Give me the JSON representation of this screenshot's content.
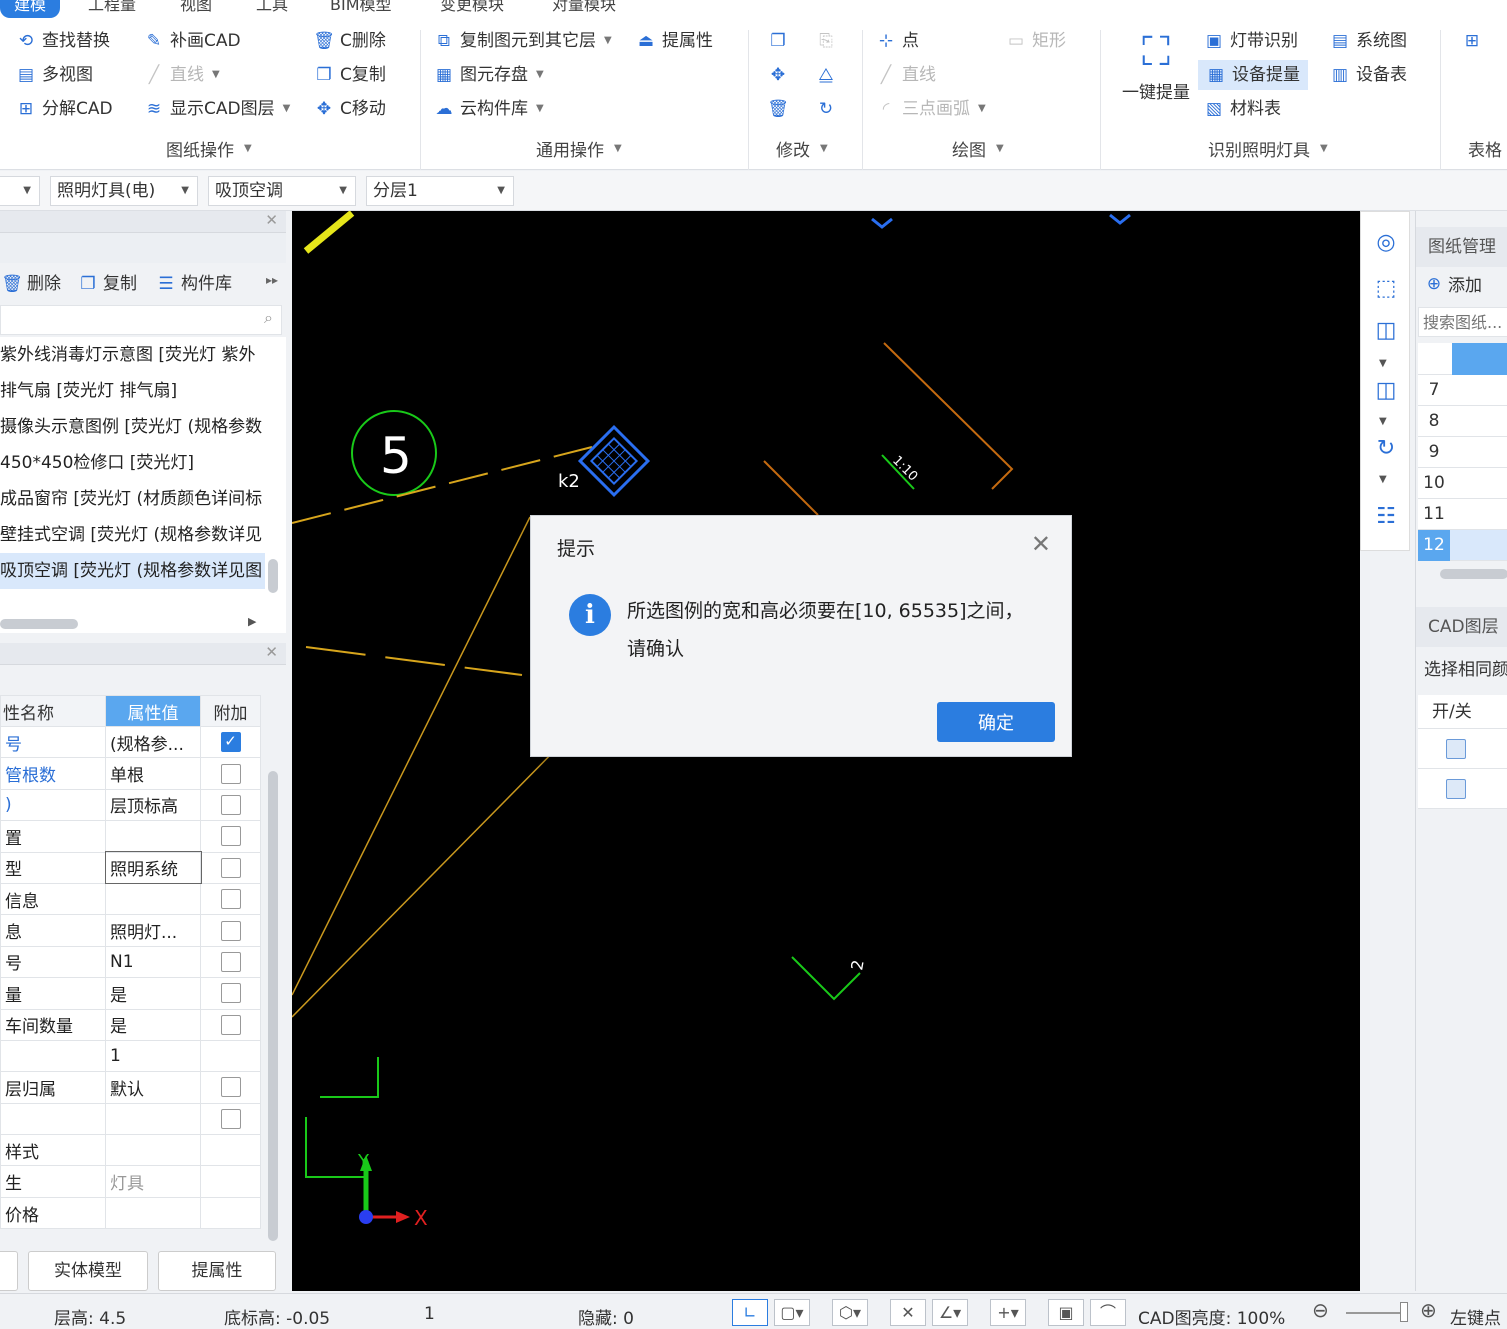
{
  "menu_tabs": [
    "建模",
    "工程量",
    "视图",
    "工具",
    "BIM模型",
    "变更模块",
    "对量模块"
  ],
  "ribbon": {
    "drawing_ops": {
      "label": "图纸操作",
      "items": [
        "查找替换",
        "补画CAD",
        "C删除",
        "多视图",
        "直线",
        "C复制",
        "分解CAD",
        "显示CAD图层",
        "C移动"
      ]
    },
    "general_ops": {
      "label": "通用操作",
      "items": [
        "复制图元到其它层",
        "提属性",
        "图元存盘",
        "云构件库"
      ]
    },
    "modify": {
      "label": "修改"
    },
    "draw": {
      "label": "绘图",
      "items": [
        "点",
        "矩形",
        "直线",
        "三点画弧"
      ]
    },
    "recognize": {
      "label": "识别照明灯具",
      "items": [
        "一键提量",
        "灯带识别",
        "系统图",
        "设备提量",
        "设备表",
        "材料表"
      ]
    },
    "table_label": "表格"
  },
  "toolbar2": {
    "dropdowns": [
      "照明灯具(电)",
      "吸顶空调",
      "分层1"
    ]
  },
  "left_panel": {
    "actions": [
      "删除",
      "复制",
      "构件库"
    ],
    "list_items": [
      "紫外线消毒灯示意图 [荧光灯 紫外",
      "排气扇 [荧光灯 排气扇]",
      "摄像头示意图例 [荧光灯 (规格参数",
      "450*450检修口 [荧光灯]",
      "成品窗帘 [荧光灯 (材质颜色详间标",
      "壁挂式空调 [荧光灯 (规格参数详见",
      "吸顶空调 [荧光灯 (规格参数详见图"
    ],
    "props_headers": [
      "性名称",
      "属性值",
      "附加"
    ],
    "props_rows": [
      {
        "name": "号",
        "value": "(规格参...",
        "checked": true,
        "blue": true
      },
      {
        "name": "管根数",
        "value": "单根",
        "checked": false,
        "blue": true
      },
      {
        "name": ")",
        "value": "层顶标高",
        "checked": false,
        "blue": true
      },
      {
        "name": "置",
        "value": "",
        "checked": false,
        "blue": false
      },
      {
        "name": "型",
        "value": "照明系统",
        "checked": false,
        "blue": false
      },
      {
        "name": "信息",
        "value": "",
        "checked": false,
        "blue": false
      },
      {
        "name": "息",
        "value": "照明灯...",
        "checked": false,
        "blue": false
      },
      {
        "name": "号",
        "value": "N1",
        "checked": false,
        "blue": false
      },
      {
        "name": "量",
        "value": "是",
        "checked": false,
        "blue": false
      },
      {
        "name": "车间数量",
        "value": "是",
        "checked": false,
        "blue": false
      },
      {
        "name": "",
        "value": "1",
        "checked": null,
        "blue": false
      },
      {
        "name": "层归属",
        "value": "默认",
        "checked": false,
        "blue": false
      },
      {
        "name": "",
        "value": "",
        "checked": false,
        "blue": false
      },
      {
        "name": "样式",
        "value": "",
        "checked": null,
        "blue": false
      },
      {
        "name": "生",
        "value": "灯具",
        "checked": null,
        "blue": false,
        "gray": true
      },
      {
        "name": "价格",
        "value": "",
        "checked": null,
        "blue": false
      }
    ],
    "bottom_buttons": [
      "实体模型",
      "提属性"
    ]
  },
  "canvas": {
    "circle_label": "5",
    "device_label": "k2",
    "scale_label": "1:10",
    "green_label": "2",
    "axis_x": "X",
    "axis_y": "Y"
  },
  "right_panel": {
    "drawing_mgmt": "图纸管理",
    "add": "添加",
    "search_placeholder": "搜索图纸...",
    "rows": [
      "7",
      "8",
      "9",
      "10",
      "11",
      "12"
    ],
    "cad_layer": "CAD图层",
    "select_same": "选择相同颜",
    "on_off": "开/关"
  },
  "status_bar": {
    "floor_height": "层高: 4.5",
    "base_elev": "底标高: -0.05",
    "count": "1",
    "hidden": "隐藏: 0",
    "cad_brightness": "CAD图亮度: 100%",
    "left_click": "左键点"
  },
  "dialog": {
    "title": "提示",
    "message": "所选图例的宽和高必须要在[10, 65535]之间，请确认",
    "ok": "确定"
  },
  "colors": {
    "accent": "#2b7de0",
    "canvas_bg": "#000000"
  }
}
